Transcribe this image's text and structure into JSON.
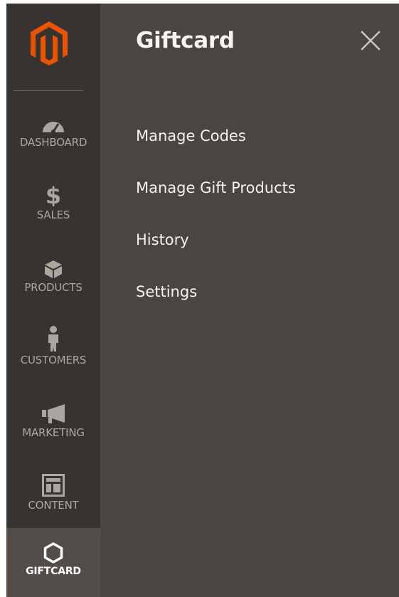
{
  "sidebar": {
    "logo": "magento-logo",
    "items": [
      {
        "label": "DASHBOARD",
        "icon": "speedometer-icon"
      },
      {
        "label": "SALES",
        "icon": "dollar-icon"
      },
      {
        "label": "PRODUCTS",
        "icon": "box-icon"
      },
      {
        "label": "CUSTOMERS",
        "icon": "person-icon"
      },
      {
        "label": "MARKETING",
        "icon": "megaphone-icon"
      },
      {
        "label": "CONTENT",
        "icon": "layout-icon"
      },
      {
        "label": "GIFTCARD",
        "icon": "hexagon-icon",
        "active": true
      }
    ]
  },
  "panel": {
    "title": "Giftcard",
    "close_icon": "close-icon",
    "items": [
      {
        "label": "Manage Codes"
      },
      {
        "label": "Manage Gift Products"
      },
      {
        "label": "History"
      },
      {
        "label": "Settings"
      }
    ]
  },
  "colors": {
    "sidebar_bg": "#373330",
    "panel_bg": "#4a4542",
    "active_bg": "#524d49",
    "logo_orange": "#eb5202",
    "inactive_text": "#aaa6a0",
    "panel_text": "#f3f1ee"
  }
}
